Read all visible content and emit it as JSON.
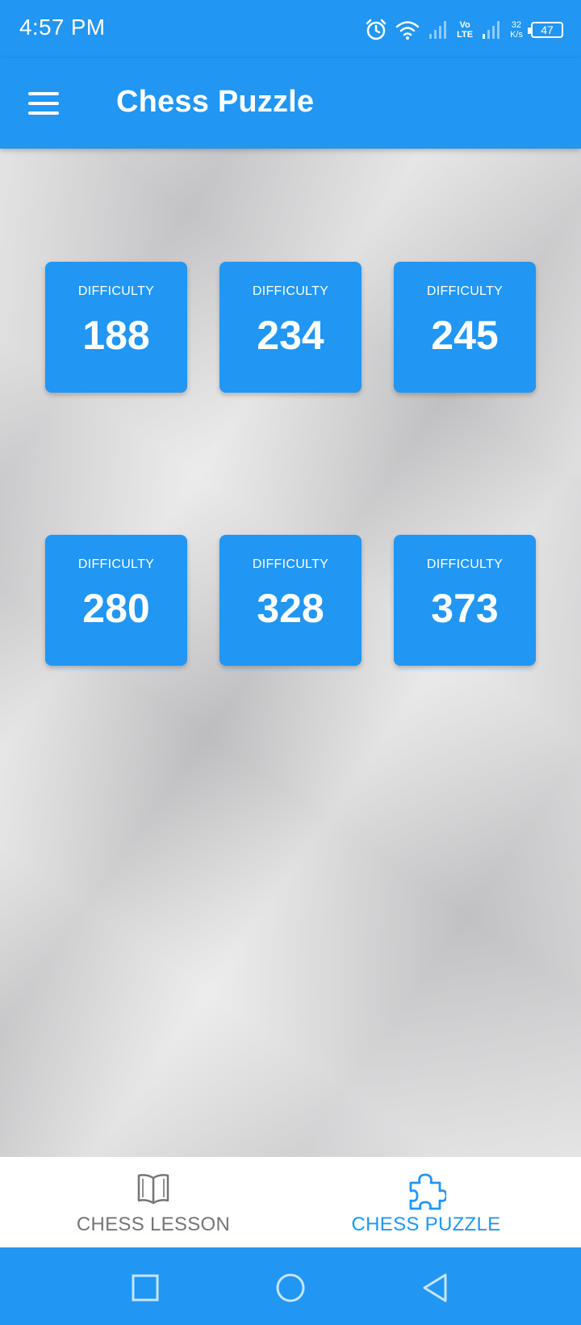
{
  "status_bar": {
    "time": "4:57 PM",
    "network_top": "Vo",
    "network_bottom": "LTE",
    "speed_top": "32",
    "speed_bottom": "K/s",
    "battery": "47"
  },
  "app_bar": {
    "title": "Chess Puzzle"
  },
  "tiles": [
    {
      "label": "DIFFICULTY",
      "value": "188"
    },
    {
      "label": "DIFFICULTY",
      "value": "234"
    },
    {
      "label": "DIFFICULTY",
      "value": "245"
    },
    {
      "label": "DIFFICULTY",
      "value": "280"
    },
    {
      "label": "DIFFICULTY",
      "value": "328"
    },
    {
      "label": "DIFFICULTY",
      "value": "373"
    }
  ],
  "bottom_nav": {
    "lesson": {
      "label": "CHESS LESSON",
      "icon": "book-icon"
    },
    "puzzle": {
      "label": "CHESS PUZZLE",
      "icon": "puzzle-icon"
    }
  },
  "colors": {
    "primary": "#2196F3",
    "inactive": "#757575"
  }
}
